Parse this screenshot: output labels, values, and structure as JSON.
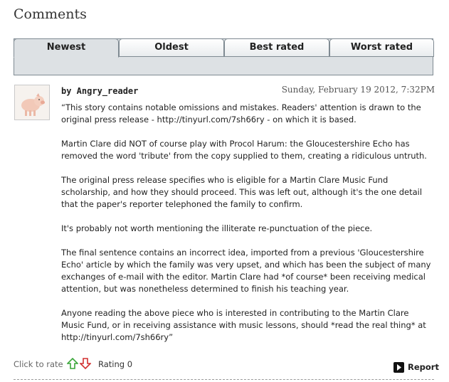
{
  "heading": "Comments",
  "tabs": [
    {
      "label": "Newest",
      "active": true
    },
    {
      "label": "Oldest",
      "active": false
    },
    {
      "label": "Best rated",
      "active": false
    },
    {
      "label": "Worst rated",
      "active": false
    }
  ],
  "comment": {
    "avatar_icon": "pig-avatar-icon",
    "author": "by Angry_reader",
    "date": "Sunday, February 19 2012, 7:32PM",
    "paragraphs": [
      "“This story contains notable omissions and mistakes. Readers' attention is drawn to the original press release - http://tinyurl.com/7sh66ry - on which it is based.",
      "Martin Clare did NOT of course play with Procol Harum: the Gloucestershire Echo has removed the word 'tribute' from the copy supplied to them, creating a ridiculous untruth.",
      "The original press release specifies who is eligible for a Martin Clare Music Fund scholarship, and how they should proceed. This was left out, although it's the one detail that the paper's reporter telephoned the family to confirm.",
      "It's probably not worth mentioning the illiterate re-punctuation of the piece.",
      "The final sentence contains an incorrect idea, imported from a previous 'Gloucestershire Echo' article by which the family was very upset, and which has been the subject of many exchanges of e-mail with the editor. Martin Clare had *of course* been receiving medical attention, but was nonetheless determined to finish his teaching year.",
      "Anyone reading the above piece who is interested in contributing to the Martin Clare Music Fund, or in receiving assistance with music lessons, should *read the real thing* at http://tinyurl.com/7sh66ry”"
    ]
  },
  "footer": {
    "click_to_rate": "Click to rate",
    "rating": "Rating  0",
    "report": "Report"
  },
  "colors": {
    "up_arrow": "#3aa63a",
    "down_arrow": "#d23030",
    "tab_bar": "#dde1e4"
  }
}
